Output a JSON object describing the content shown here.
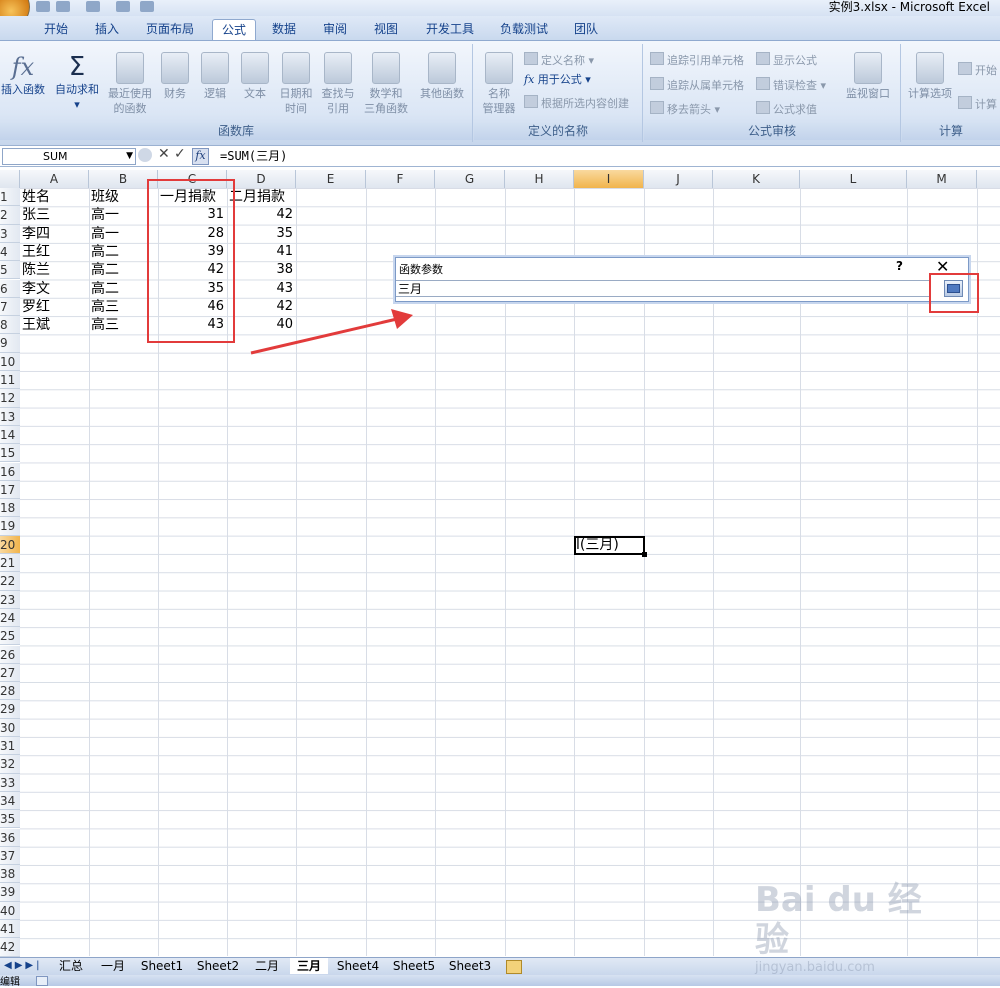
{
  "window": {
    "title": "实例3.xlsx - Microsoft Excel"
  },
  "tabs": [
    "开始",
    "插入",
    "页面布局",
    "公式",
    "数据",
    "审阅",
    "视图",
    "开发工具",
    "负载测试",
    "团队"
  ],
  "active_tab": "公式",
  "ribbon": {
    "func_lib": {
      "label": "函数库",
      "insert": "插入函数",
      "autosum": "自动求和",
      "recent": [
        "最近使用",
        "的函数"
      ],
      "finance": "财务",
      "logic": "逻辑",
      "text": "文本",
      "datetime": [
        "日期和",
        "时间"
      ],
      "lookup": [
        "查找与",
        "引用"
      ],
      "math": [
        "数学和",
        "三角函数"
      ],
      "other": "其他函数"
    },
    "names": {
      "label": "定义的名称",
      "manager": [
        "名称",
        "管理器"
      ],
      "define": "定义名称",
      "use_in": "用于公式",
      "create": "根据所选内容创建"
    },
    "audit": {
      "label": "公式审核",
      "trace_prec": "追踪引用单元格",
      "trace_dep": "追踪从属单元格",
      "remove_arrows": "移去箭头",
      "show_formula": "显示公式",
      "error_check": "错误检查",
      "evaluate": "公式求值",
      "watch": "监视窗口"
    },
    "calc": {
      "label": "计算",
      "options": "计算选项",
      "now": "开始",
      "sheet": "计算"
    }
  },
  "formula_bar": {
    "name_box": "SUM",
    "formula": "=SUM(三月)"
  },
  "columns": [
    "A",
    "B",
    "C",
    "D",
    "E",
    "F",
    "G",
    "H",
    "I",
    "J",
    "K",
    "L",
    "M"
  ],
  "rows": [
    "1",
    "2",
    "3",
    "4",
    "5",
    "6",
    "7",
    "8",
    "9",
    "10",
    "11",
    "12",
    "13",
    "14",
    "15",
    "16",
    "17",
    "18",
    "19",
    "20",
    "21",
    "22",
    "23",
    "24",
    "25",
    "26",
    "27",
    "28",
    "29",
    "30",
    "31",
    "32",
    "33",
    "34",
    "35",
    "36",
    "37",
    "38",
    "39",
    "40",
    "41",
    "42"
  ],
  "table": {
    "headers": [
      "姓名",
      "班级",
      "一月捐款",
      "二月捐款"
    ],
    "rows": [
      [
        "张三",
        "高一",
        "31",
        "42"
      ],
      [
        "李四",
        "高一",
        "28",
        "35"
      ],
      [
        "王红",
        "高二",
        "39",
        "41"
      ],
      [
        "陈兰",
        "高二",
        "42",
        "38"
      ],
      [
        "李文",
        "高二",
        "35",
        "43"
      ],
      [
        "罗红",
        "高三",
        "46",
        "42"
      ],
      [
        "王斌",
        "高三",
        "43",
        "40"
      ]
    ]
  },
  "active_cell_text": "l(三月)",
  "dialog": {
    "title": "函数参数",
    "help": "?",
    "close": "✕",
    "value": "三月"
  },
  "sheets": [
    "汇总",
    "一月",
    "Sheet1",
    "Sheet2",
    "二月",
    "三月",
    "Sheet4",
    "Sheet5",
    "Sheet3"
  ],
  "active_sheet": "三月",
  "status": "编辑",
  "watermark": {
    "logo": "Bai du 经验",
    "url": "jingyan.baidu.com"
  },
  "colors": {
    "highlight_red": "#e23b3b",
    "ribbon_blue": "#15428b"
  }
}
